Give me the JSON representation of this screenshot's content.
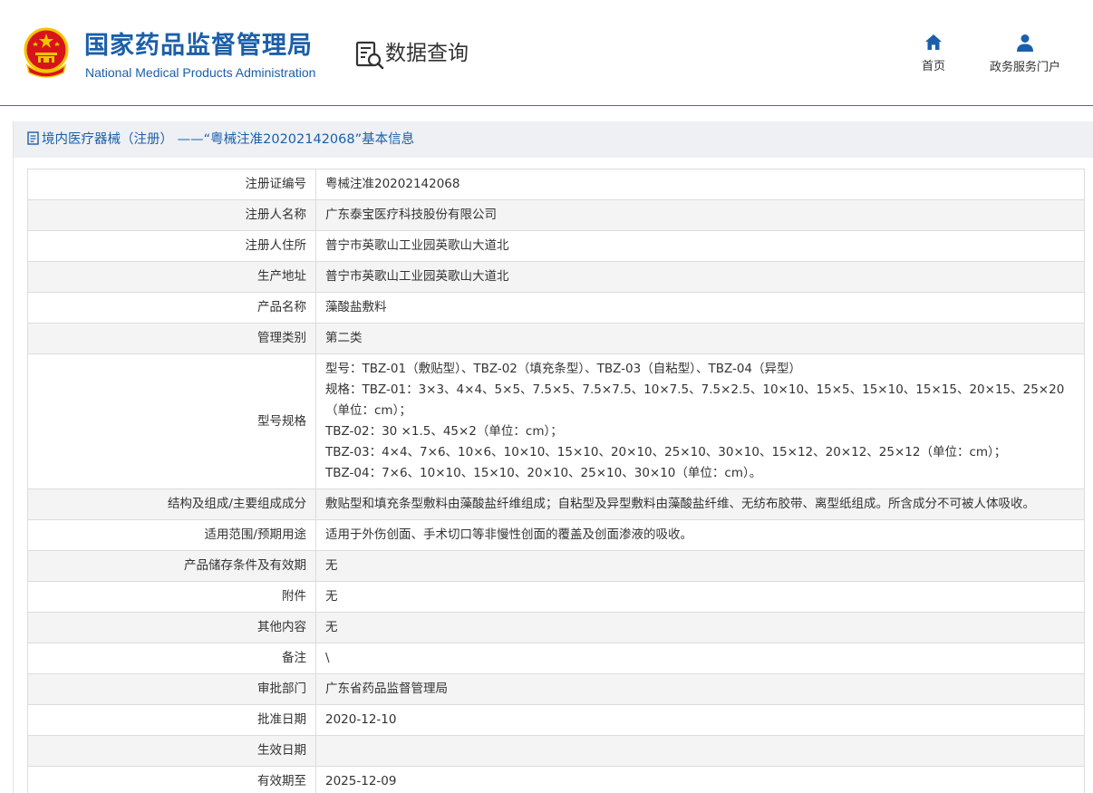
{
  "header": {
    "site_title": "国家药品监督管理局",
    "site_subtitle": "National Medical Products Administration",
    "query_title": "数据查询",
    "nav": [
      {
        "label": "首页",
        "icon": "home-icon"
      },
      {
        "label": "政务服务门户",
        "icon": "user-icon"
      }
    ]
  },
  "section": {
    "title": "境内医疗器械（注册） ——“粤械注准20202142068”基本信息"
  },
  "colors": {
    "brand_blue": "#1b5faa",
    "emblem_red": "#d7141a",
    "emblem_gold": "#f4c400"
  },
  "details": [
    {
      "label": "注册证编号",
      "value": "粤械注准20202142068"
    },
    {
      "label": "注册人名称",
      "value": "广东泰宝医疗科技股份有限公司"
    },
    {
      "label": "注册人住所",
      "value": "普宁市英歌山工业园英歌山大道北"
    },
    {
      "label": "生产地址",
      "value": "普宁市英歌山工业园英歌山大道北"
    },
    {
      "label": "产品名称",
      "value": "藻酸盐敷料"
    },
    {
      "label": "管理类别",
      "value": "第二类"
    },
    {
      "label": "型号规格",
      "lines": [
        "型号：TBZ-01（敷贴型）、TBZ-02（填充条型）、TBZ-03（自粘型）、TBZ-04（异型）",
        "规格：TBZ-01：3×3、4×4、5×5、7.5×5、7.5×7.5、10×7.5、7.5×2.5、10×10、15×5、15×10、15×15、20×15、25×20（单位：cm）；",
        "TBZ-02：30 ×1.5、45×2（单位：cm）；",
        "TBZ-03：4×4、7×6、10×6、10×10、15×10、20×10、25×10、30×10、15×12、20×12、25×12（单位：cm）；",
        "TBZ-04：7×6、10×10、15×10、20×10、25×10、30×10（单位：cm）。"
      ]
    },
    {
      "label": "结构及组成/主要组成成分",
      "value": "敷贴型和填充条型敷料由藻酸盐纤维组成；自粘型及异型敷料由藻酸盐纤维、无纺布胶带、离型纸组成。所含成分不可被人体吸收。"
    },
    {
      "label": "适用范围/预期用途",
      "value": "适用于外伤创面、手术切口等非慢性创面的覆盖及创面渗液的吸收。"
    },
    {
      "label": "产品储存条件及有效期",
      "value": "无"
    },
    {
      "label": "附件",
      "value": "无"
    },
    {
      "label": "其他内容",
      "value": "无"
    },
    {
      "label": "备注",
      "value": "\\"
    },
    {
      "label": "审批部门",
      "value": "广东省药品监督管理局"
    },
    {
      "label": "批准日期",
      "value": "2020-12-10"
    },
    {
      "label": "生效日期",
      "value": ""
    },
    {
      "label": "有效期至",
      "value": "2025-12-09"
    }
  ]
}
